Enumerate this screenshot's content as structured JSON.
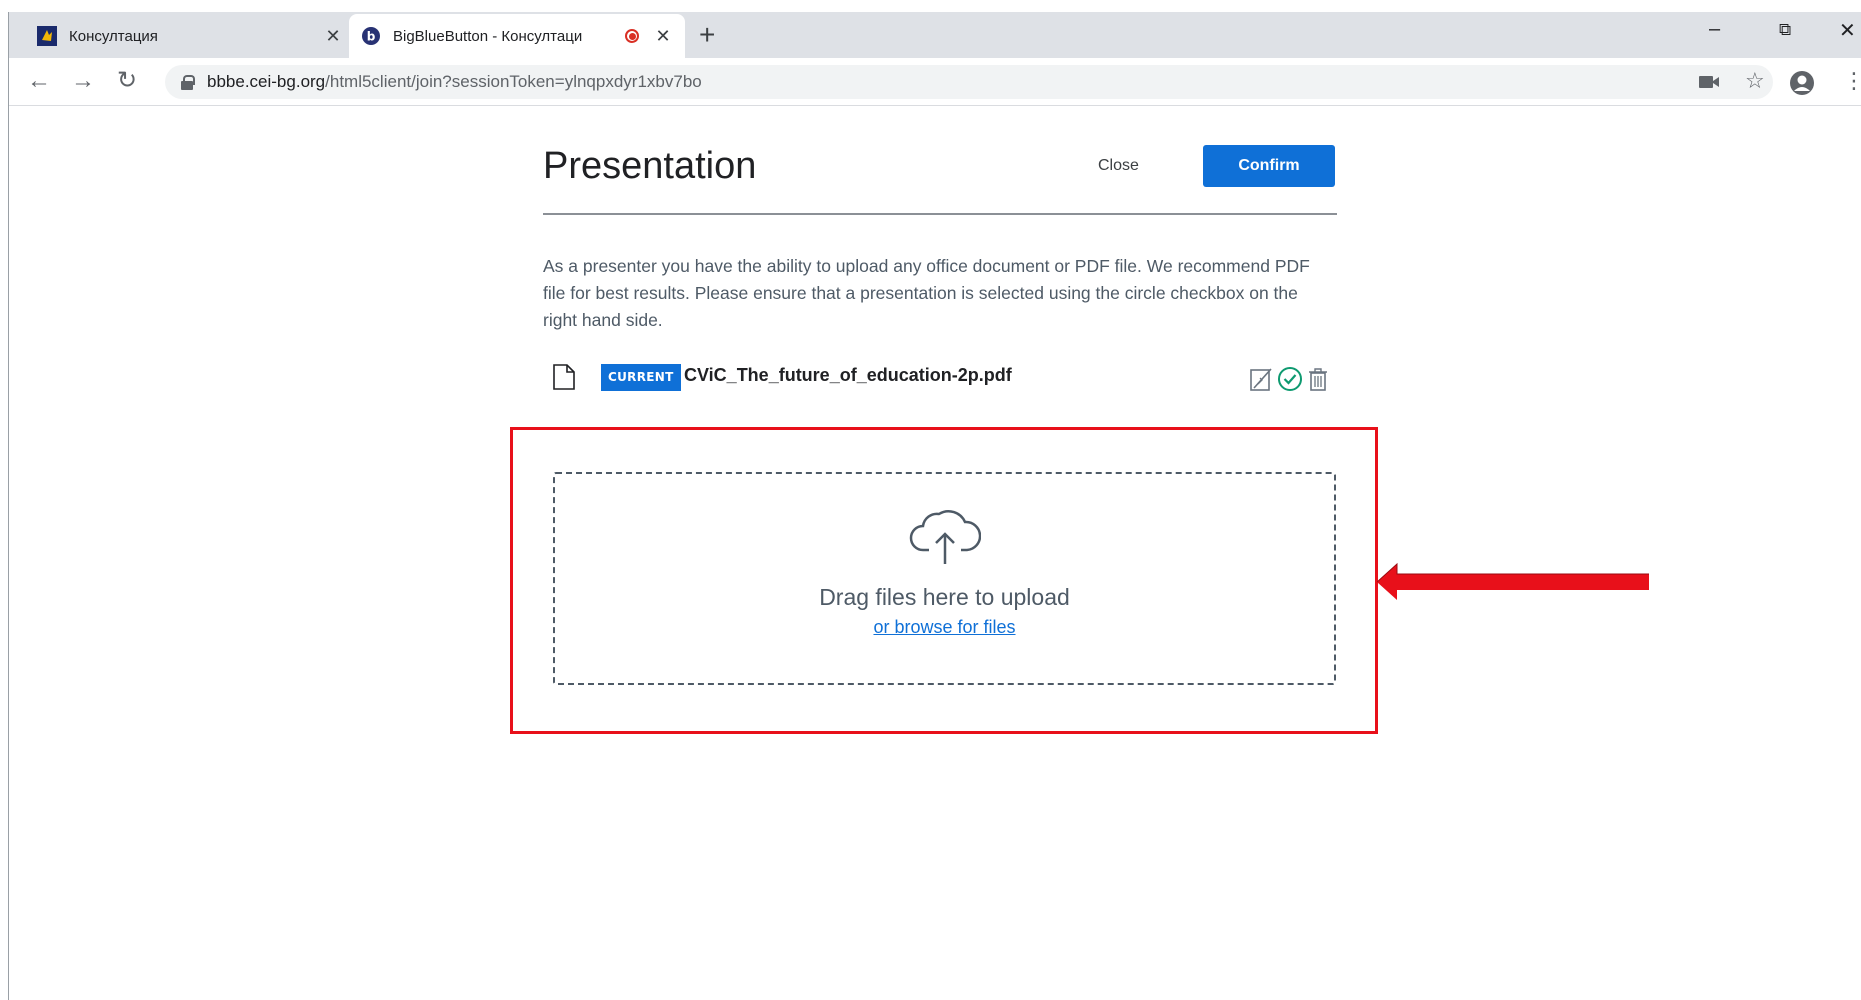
{
  "browser": {
    "tabs": [
      {
        "title": "Консултация",
        "active": false
      },
      {
        "title": "BigBlueButton - Консултаци",
        "active": true,
        "recording": true
      }
    ],
    "new_tab_label": "+",
    "window_controls": {
      "minimize": "–",
      "restore": "⧉",
      "close": "✕"
    },
    "nav": {
      "back": "←",
      "forward": "→",
      "reload": "↻"
    },
    "address_bar": {
      "host": "bbbe.cei-bg.org",
      "path": "/html5client/join?sessionToken=ylnqpxdyr1xbv7bo"
    }
  },
  "presentation_modal": {
    "title": "Presentation",
    "close_label": "Close",
    "confirm_label": "Confirm",
    "description": "As a presenter you have the ability to upload any office document or PDF file. We recommend PDF file for best results. Please ensure that a presentation is selected using the circle checkbox on the right hand side.",
    "files": [
      {
        "badge": "CURRENT",
        "name": "CViC_The_future_of_education-2p.pdf"
      }
    ],
    "dropzone": {
      "primary_text": "Drag files here to upload",
      "link_text": "or browse for files"
    }
  },
  "colors": {
    "accent": "#0f70d7",
    "highlight": "#e8101a",
    "text_muted": "#4e5a66",
    "success": "#0e9a70"
  }
}
